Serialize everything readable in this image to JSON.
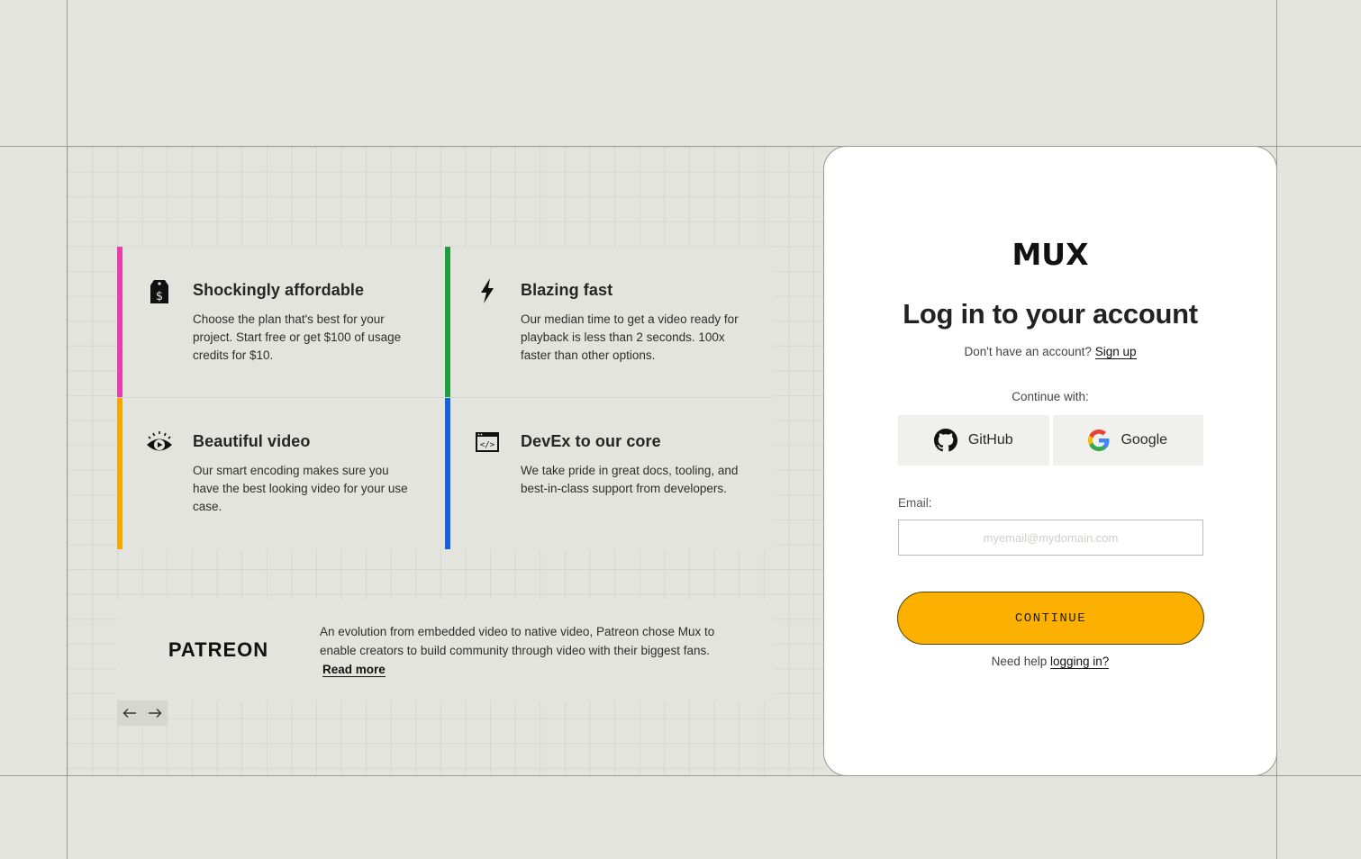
{
  "colors": {
    "page_bg": "#e4e4de",
    "accent_yellow": "#fcb000",
    "bar_pink": "#e83fae",
    "bar_green": "#1d9e3c",
    "bar_orange": "#f4a800",
    "bar_blue": "#1464d8"
  },
  "features": [
    {
      "title": "Shockingly affordable",
      "description": "Choose the plan that's best for your project. Start free or get $100 of usage credits for $10.",
      "icon": "price-tag-icon"
    },
    {
      "title": "Blazing fast",
      "description": "Our median time to get a video ready for playback is less than 2 seconds. 100x faster than other options.",
      "icon": "lightning-bolt-icon"
    },
    {
      "title": "Beautiful video",
      "description": "Our smart encoding makes sure you have the best looking video for your use case.",
      "icon": "eye-play-icon"
    },
    {
      "title": "DevEx to our core",
      "description": "We take pride in great docs, tooling, and best-in-class support from developers.",
      "icon": "code-window-icon"
    }
  ],
  "testimonial": {
    "logo_text": "PATREON",
    "quote": "An evolution from embedded video to native video, Patreon chose Mux to enable creators to build community through video with their biggest fans.",
    "read_more": "Read more"
  },
  "carousel": {
    "prev_icon": "arrow-left-icon",
    "next_icon": "arrow-right-icon"
  },
  "login": {
    "logo_text": "MUX",
    "title": "Log in to your account",
    "no_account_text": "Don't have an account?",
    "signup_link": "Sign up",
    "continue_with": "Continue with:",
    "github_label": "GitHub",
    "google_label": "Google",
    "email_label": "Email:",
    "email_placeholder": "myemail@mydomain.com",
    "email_value": "",
    "continue_button": "CONTINUE",
    "help_text": "Need help",
    "help_link": "logging in?"
  }
}
